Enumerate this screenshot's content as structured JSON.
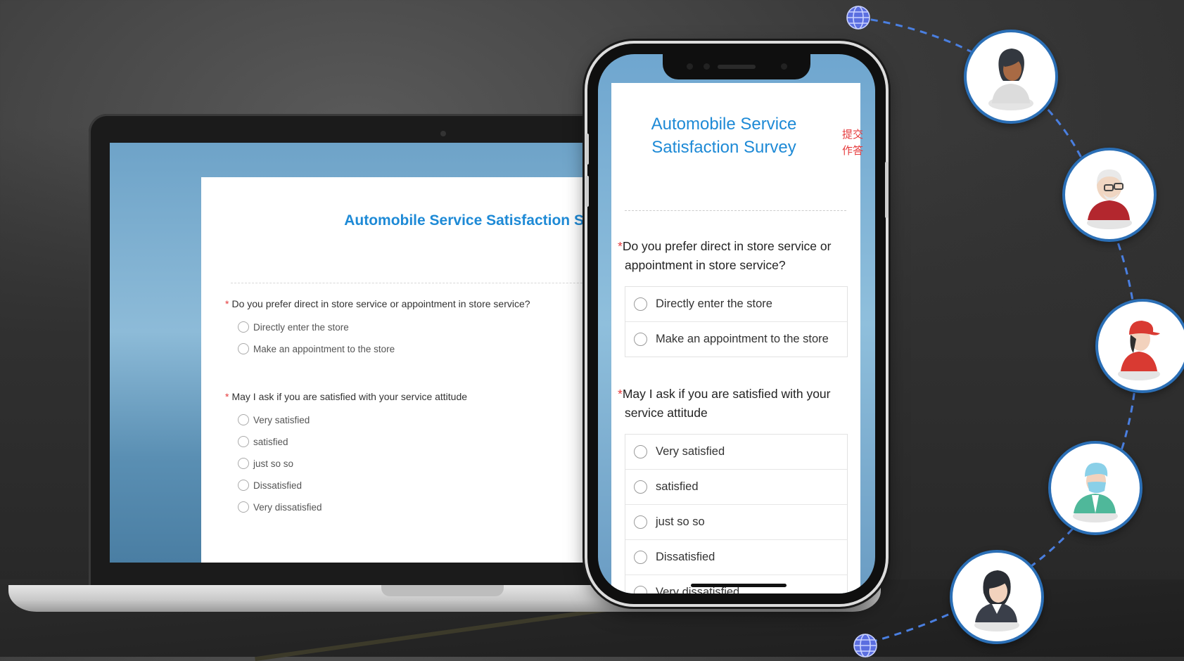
{
  "desktop_survey": {
    "title": "Automobile Service Satisfaction Survey",
    "q1": {
      "required_mark": "*",
      "text": "Do you prefer direct in store service or appointment in store service?",
      "options": [
        "Directly enter the store",
        "Make an appointment to the store"
      ]
    },
    "q2": {
      "required_mark": "*",
      "text": "May I ask if you are satisfied with your service attitude",
      "options": [
        "Very satisfied",
        "satisfied",
        "just so so",
        "Dissatisfied",
        "Very dissatisfied"
      ]
    }
  },
  "mobile_survey": {
    "title_line1": "Automobile Service",
    "title_line2": "Satisfaction Survey",
    "side_action_1": "提交",
    "side_action_2": "作答",
    "q1": {
      "required_mark": "*",
      "text_line1": "Do you prefer direct in store service or",
      "text_line2": "appointment in store service?",
      "options": [
        "Directly enter the store",
        "Make an appointment to the store"
      ]
    },
    "q2": {
      "required_mark": "*",
      "text_line1": "May I ask if you are satisfied with your",
      "text_line2": "service attitude",
      "options": [
        "Very satisfied",
        "satisfied",
        "just so so",
        "Dissatisfied",
        "Very dissatisfied"
      ]
    }
  },
  "colors": {
    "accent": "#1e8ad6",
    "required": "#e5393b",
    "avatar_ring": "#2b6fb6",
    "connector": "#4a7fe0"
  },
  "avatars": [
    {
      "icon": "woman-avatar-icon"
    },
    {
      "icon": "elderly-man-avatar-icon"
    },
    {
      "icon": "delivery-worker-avatar-icon"
    },
    {
      "icon": "doctor-avatar-icon"
    },
    {
      "icon": "businesswoman-avatar-icon"
    }
  ]
}
